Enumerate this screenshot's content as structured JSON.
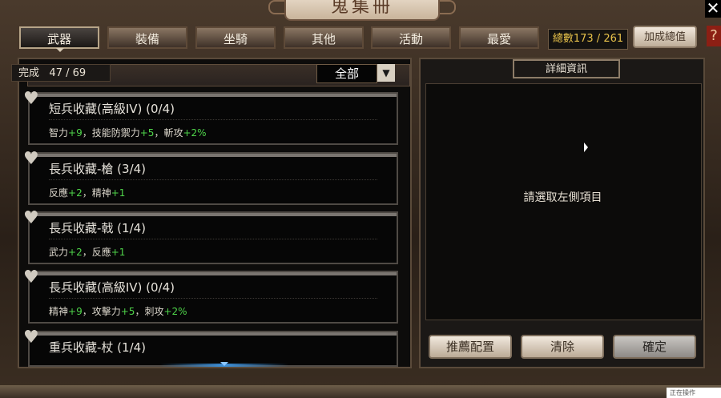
{
  "window": {
    "title": "鬼集冊",
    "close_icon": "✕",
    "help_icon": "?"
  },
  "tabs": [
    {
      "label": "武器",
      "active": true
    },
    {
      "label": "裝備",
      "active": false
    },
    {
      "label": "坐騎",
      "active": false
    },
    {
      "label": "其他",
      "active": false
    },
    {
      "label": "活動",
      "active": false
    },
    {
      "label": "最愛",
      "active": false
    }
  ],
  "total": {
    "label": "總數",
    "value": "173 / 261"
  },
  "bonus_button": "加成總值",
  "list": {
    "complete_label": "完成",
    "complete_value": "47 / 69",
    "filter": "全部",
    "filter_arrow": "▼",
    "items": [
      {
        "title": "短兵收藏(高級IV) (0/4)",
        "stats": [
          {
            "t": "智力"
          },
          {
            "g": "+9"
          },
          {
            "t": "，技能防禦力"
          },
          {
            "g": "+5"
          },
          {
            "t": "，斬攻"
          },
          {
            "g": "+2%"
          }
        ]
      },
      {
        "title": "長兵收藏-槍 (3/4)",
        "stats": [
          {
            "t": "反應"
          },
          {
            "g": "+2"
          },
          {
            "t": "，精神"
          },
          {
            "g": "+1"
          }
        ]
      },
      {
        "title": "長兵收藏-戟 (1/4)",
        "stats": [
          {
            "t": "武力"
          },
          {
            "g": "+2"
          },
          {
            "t": "，反應"
          },
          {
            "g": "+1"
          }
        ]
      },
      {
        "title": "長兵收藏(高級IV) (0/4)",
        "stats": [
          {
            "t": "精神"
          },
          {
            "g": "+9"
          },
          {
            "t": "，攻擊力"
          },
          {
            "g": "+5"
          },
          {
            "t": "，刺攻"
          },
          {
            "g": "+2%"
          }
        ]
      },
      {
        "title": "重兵收藏-杖 (1/4)",
        "stats": []
      }
    ]
  },
  "detail": {
    "title": "詳細資訊",
    "placeholder": "請選取左側項目",
    "buttons": [
      "推薦配置",
      "清除",
      "確定"
    ]
  },
  "watermark": "正在操作"
}
